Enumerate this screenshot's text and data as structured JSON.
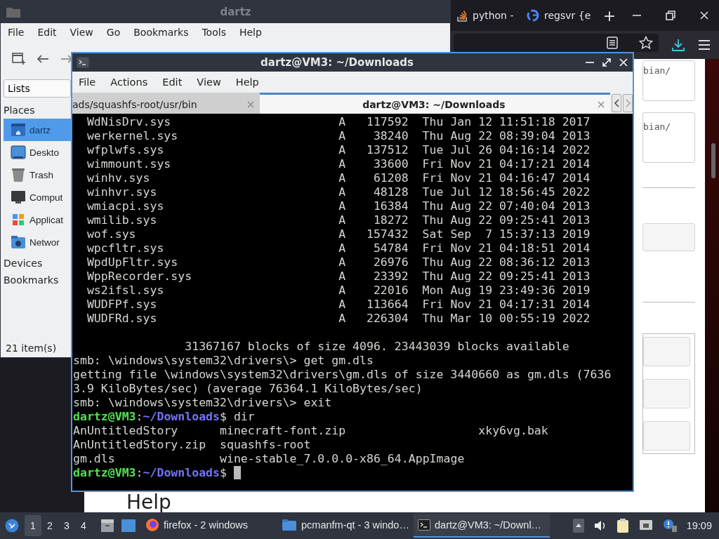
{
  "browser": {
    "tabs": [
      {
        "title": "python -",
        "kind": "stack",
        "selected": false
      },
      {
        "title": "regsvr {e",
        "kind": "google",
        "selected": false
      }
    ],
    "new_tab": "+",
    "snippets": [
      "bian/",
      "bian/"
    ],
    "heading": "Help"
  },
  "file_manager": {
    "title": "dartz",
    "menu": [
      "File",
      "Edit",
      "View",
      "Go",
      "Bookmarks",
      "Tools",
      "Help"
    ],
    "view_selector": "Lists",
    "sections": [
      {
        "header": "Places",
        "items": [
          {
            "label": "dartz",
            "kind": "home",
            "selected": true
          },
          {
            "label": "Deskto",
            "kind": "desktop",
            "selected": false
          },
          {
            "label": "Trash",
            "kind": "trash",
            "selected": false
          },
          {
            "label": "Comput",
            "kind": "computer",
            "selected": false
          },
          {
            "label": "Applicat",
            "kind": "apps",
            "selected": false
          },
          {
            "label": "Networ",
            "kind": "network",
            "selected": false
          }
        ]
      },
      {
        "header": "Devices"
      },
      {
        "header": "Bookmarks"
      }
    ],
    "status": "21 item(s)"
  },
  "terminal": {
    "title": "dartz@VM3: ~/Downloads",
    "menu": [
      "File",
      "Actions",
      "Edit",
      "View",
      "Help"
    ],
    "tabs": [
      {
        "title": "ads/squashfs-root/usr/bin",
        "selected": false
      },
      {
        "title": "dartz@VM3: ~/Downloads",
        "selected": true
      }
    ],
    "lines": [
      {
        "kind": "file",
        "name": "WdNisDrv.sys",
        "attr": "A",
        "size": "117592",
        "date": "Thu Jan 12 11:51:18 2017"
      },
      {
        "kind": "file",
        "name": "werkernel.sys",
        "attr": "A",
        "size": "38240",
        "date": "Thu Aug 22 08:39:04 2013"
      },
      {
        "kind": "file",
        "name": "wfplwfs.sys",
        "attr": "A",
        "size": "137512",
        "date": "Tue Jul 26 04:16:14 2022"
      },
      {
        "kind": "file",
        "name": "wimmount.sys",
        "attr": "A",
        "size": "33600",
        "date": "Fri Nov 21 04:17:21 2014"
      },
      {
        "kind": "file",
        "name": "winhv.sys",
        "attr": "A",
        "size": "61208",
        "date": "Fri Nov 21 04:16:47 2014"
      },
      {
        "kind": "file",
        "name": "winhvr.sys",
        "attr": "A",
        "size": "48128",
        "date": "Tue Jul 12 18:56:45 2022"
      },
      {
        "kind": "file",
        "name": "wmiacpi.sys",
        "attr": "A",
        "size": "16384",
        "date": "Thu Aug 22 07:40:04 2013"
      },
      {
        "kind": "file",
        "name": "wmilib.sys",
        "attr": "A",
        "size": "18272",
        "date": "Thu Aug 22 09:25:41 2013"
      },
      {
        "kind": "file",
        "name": "wof.sys",
        "attr": "A",
        "size": "157432",
        "date": "Sat Sep  7 15:37:13 2019"
      },
      {
        "kind": "file",
        "name": "wpcfltr.sys",
        "attr": "A",
        "size": "54784",
        "date": "Fri Nov 21 04:18:51 2014"
      },
      {
        "kind": "file",
        "name": "WpdUpFltr.sys",
        "attr": "A",
        "size": "26976",
        "date": "Thu Aug 22 08:36:12 2013"
      },
      {
        "kind": "file",
        "name": "WppRecorder.sys",
        "attr": "A",
        "size": "23392",
        "date": "Thu Aug 22 09:25:41 2013"
      },
      {
        "kind": "file",
        "name": "ws2ifsl.sys",
        "attr": "A",
        "size": "22016",
        "date": "Mon Aug 19 23:49:36 2019"
      },
      {
        "kind": "file",
        "name": "WUDFPf.sys",
        "attr": "A",
        "size": "113664",
        "date": "Fri Nov 21 04:17:31 2014"
      },
      {
        "kind": "file",
        "name": "WUDFRd.sys",
        "attr": "A",
        "size": "226304",
        "date": "Thu Mar 10 00:55:19 2022"
      },
      {
        "kind": "blank"
      },
      {
        "kind": "summary",
        "text": "31367167 blocks of size 4096. 23443039 blocks available"
      },
      {
        "kind": "text",
        "text": "smb: \\windows\\system32\\drivers\\> get gm.dls"
      },
      {
        "kind": "text",
        "text": "getting file \\windows\\system32\\drivers\\gm.dls of size 3440660 as gm.dls (7636"
      },
      {
        "kind": "text",
        "text": "3.9 KiloBytes/sec) (average 76364.1 KiloBytes/sec)"
      },
      {
        "kind": "text",
        "text": "smb: \\windows\\system32\\drivers\\> exit"
      },
      {
        "kind": "prompt",
        "user": "dartz@VM3",
        "sep": ":",
        "path": "~/Downloads",
        "tail": "$ dir"
      },
      {
        "kind": "columns",
        "cells": [
          "AnUntitledStory",
          "minecraft-font.zip",
          "xky6vg.bak"
        ]
      },
      {
        "kind": "columns",
        "cells": [
          "AnUntitledStory.zip",
          "squashfs-root"
        ]
      },
      {
        "kind": "columns",
        "cells": [
          "gm.dls",
          "wine-stable_7.0.0.0-x86_64.AppImage"
        ]
      },
      {
        "kind": "prompt",
        "user": "dartz@VM3",
        "sep": ":",
        "path": "~/Downloads",
        "tail": "$",
        "cursor": true
      }
    ]
  },
  "taskbar": {
    "workspaces": [
      {
        "label": "1",
        "selected": true
      },
      {
        "label": "2",
        "selected": false
      },
      {
        "label": "3",
        "selected": false
      },
      {
        "label": "4",
        "selected": false
      }
    ],
    "tasks": [
      {
        "title": "firefox - 2 windows",
        "kind": "firefox",
        "selected": false
      },
      {
        "title": "pcmanfm-qt - 3 windo…",
        "kind": "folder",
        "selected": false
      },
      {
        "title": "dartz@VM3: ~/Downl…",
        "kind": "terminal",
        "selected": true
      }
    ],
    "clock": "19:09"
  }
}
